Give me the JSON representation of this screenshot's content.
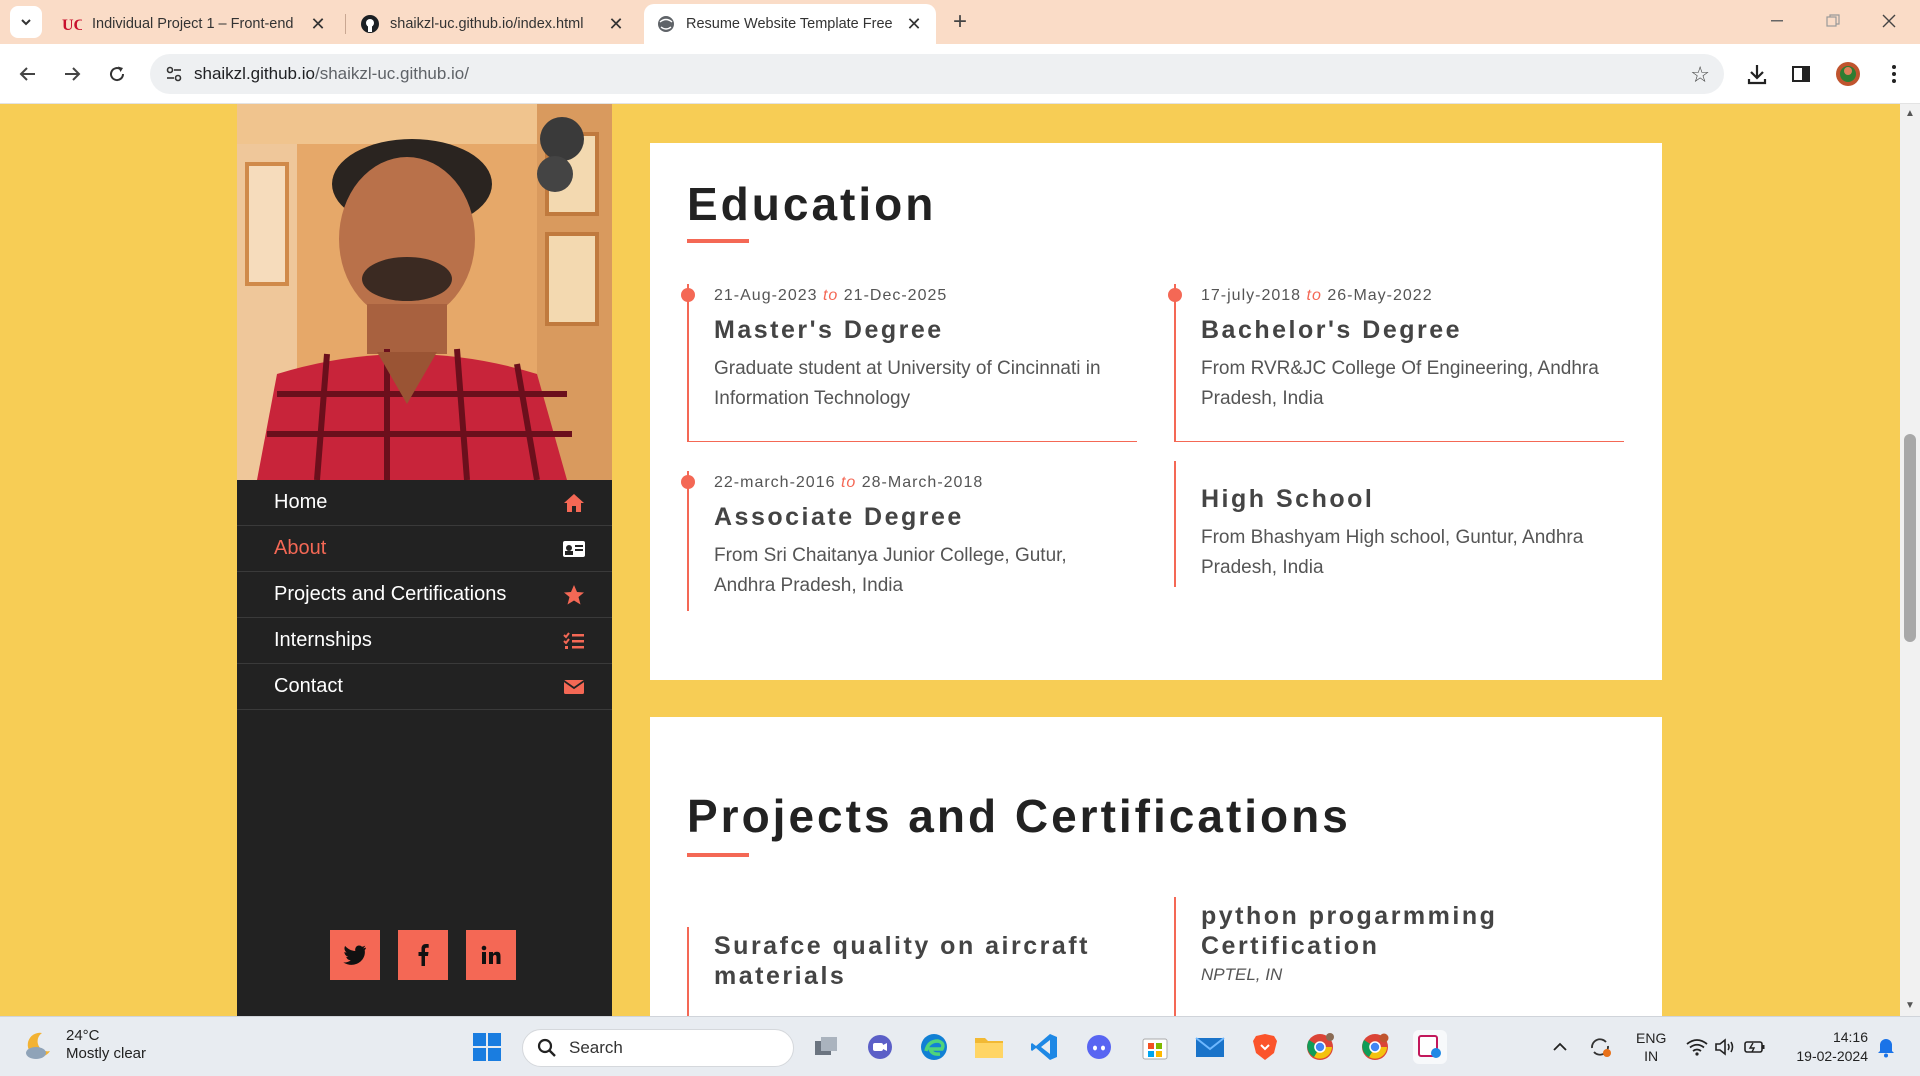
{
  "browser": {
    "tabs": [
      {
        "title": "Individual Project 1 – Front-end",
        "favicon": "uc-logo-icon"
      },
      {
        "title": "shaikzl-uc.github.io/index.html",
        "favicon": "github-icon"
      },
      {
        "title": "Resume Website Template Free",
        "favicon": "globe-icon",
        "active": true
      }
    ],
    "url_host": "shaikzl.github.io",
    "url_path": "/shaikzl-uc.github.io/"
  },
  "sidebar": {
    "menu": [
      {
        "label": "Home",
        "icon": "home-icon"
      },
      {
        "label": "About",
        "icon": "id-card-icon",
        "active": true
      },
      {
        "label": "Projects and Certifications",
        "icon": "star-icon"
      },
      {
        "label": "Internships",
        "icon": "list-icon"
      },
      {
        "label": "Contact",
        "icon": "envelope-icon"
      }
    ],
    "socials": [
      "twitter",
      "facebook",
      "linkedin"
    ]
  },
  "education": {
    "heading": "Education",
    "items": [
      {
        "from": "21-Aug-2023",
        "to_word": "to",
        "to": "21-Dec-2025",
        "title": "Master's Degree",
        "desc": "Graduate student at University of Cincinnati in Information Technology"
      },
      {
        "from": "17-july-2018",
        "to_word": "to",
        "to": "26-May-2022",
        "title": "Bachelor's Degree",
        "desc": "From RVR&JC College Of Engineering, Andhra Pradesh, India"
      },
      {
        "from": "22-march-2016",
        "to_word": "to",
        "to": "28-March-2018",
        "title": "Associate Degree",
        "desc": "From Sri Chaitanya Junior College, Gutur, Andhra Pradesh, India"
      },
      {
        "title": "High School",
        "desc": "From Bhashyam High school, Guntur, Andhra Pradesh, India"
      }
    ]
  },
  "projects": {
    "heading": "Projects and Certifications",
    "items": [
      {
        "title": "Surafce quality on aircraft materials"
      },
      {
        "title": "python progarmming Certification",
        "sub": "NPTEL, IN"
      }
    ]
  },
  "taskbar": {
    "temp": "24°C",
    "weather": "Mostly clear",
    "search_placeholder": "Search",
    "lang1": "ENG",
    "lang2": "IN",
    "time": "14:16",
    "date": "19-02-2024"
  },
  "colors": {
    "accent": "#f46855",
    "page_bg": "#f7cd55",
    "sidebar_bg": "#222222"
  }
}
